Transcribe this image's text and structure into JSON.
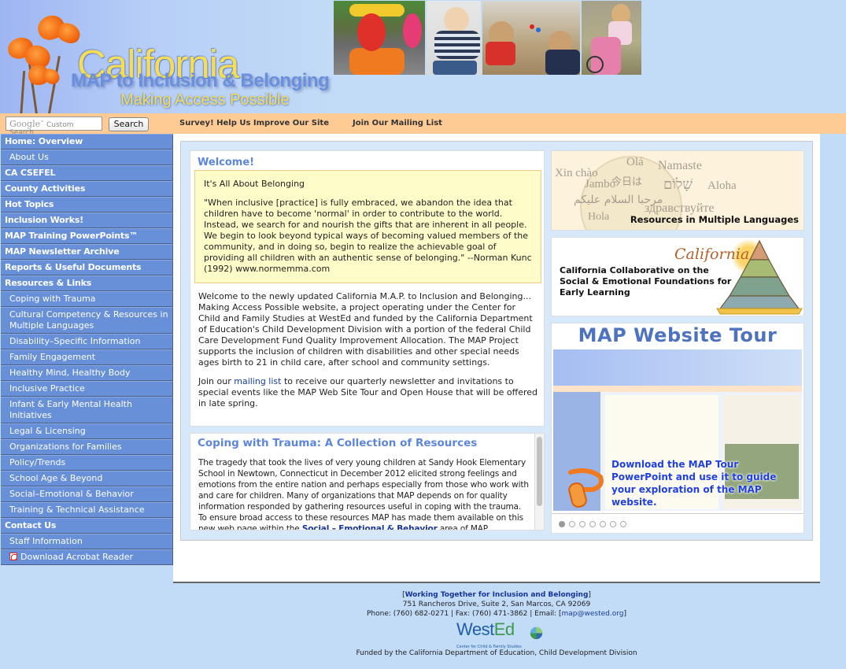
{
  "header": {
    "logo_line1": "California",
    "logo_line2": "MAP to Inclusion & Belonging",
    "logo_line3": "Making Access Possible"
  },
  "topbar": {
    "search_placeholder_brand": "Google",
    "search_placeholder": "Custom Search",
    "search_button": "Search",
    "links": [
      "Survey! Help Us Improve Our Site",
      "Join Our Mailing List"
    ]
  },
  "sidebar": {
    "items": [
      {
        "label": "Home: Overview",
        "level": "top"
      },
      {
        "label": "About Us",
        "level": "sub"
      },
      {
        "label": "CA CSEFEL",
        "level": "top"
      },
      {
        "label": "County Activities",
        "level": "top"
      },
      {
        "label": "Hot Topics",
        "level": "top"
      },
      {
        "label": "Inclusion Works!",
        "level": "top"
      },
      {
        "label": "MAP Training PowerPoints™",
        "level": "top"
      },
      {
        "label": "MAP Newsletter Archive",
        "level": "top"
      },
      {
        "label": "Reports & Useful Documents",
        "level": "top"
      },
      {
        "label": "Resources & Links",
        "level": "top"
      },
      {
        "label": "Coping with Trauma",
        "level": "sub"
      },
      {
        "label": "Cultural Competency & Resources in Multiple Languages",
        "level": "sub"
      },
      {
        "label": "Disability–Specific Information",
        "level": "sub"
      },
      {
        "label": "Family Engagement",
        "level": "sub"
      },
      {
        "label": "Healthy Mind, Healthy Body",
        "level": "sub"
      },
      {
        "label": "Inclusive Practice",
        "level": "sub"
      },
      {
        "label": "Infant & Early Mental Health Initiatives",
        "level": "sub"
      },
      {
        "label": "Legal & Licensing",
        "level": "sub"
      },
      {
        "label": "Organizations for Families",
        "level": "sub"
      },
      {
        "label": "Policy/Trends",
        "level": "sub"
      },
      {
        "label": "School Age & Beyond",
        "level": "sub"
      },
      {
        "label": "Social–Emotional & Behavior",
        "level": "sub"
      },
      {
        "label": "Training & Technical Assistance",
        "level": "sub"
      },
      {
        "label": "Contact Us",
        "level": "top"
      },
      {
        "label": "Staff Information",
        "level": "sub"
      },
      {
        "label": "Download Acrobat Reader",
        "level": "sub",
        "icon": "pdf-icon"
      }
    ]
  },
  "welcome": {
    "title": "Welcome!",
    "quote_heading": "It's All About Belonging",
    "quote": "\"When inclusive [practice] is fully embraced, we abandon the idea that children have to become 'normal' in order to contribute to the world. Instead, we search for and nourish the gifts that are inherent in all people. We begin to look beyond typical ways of becoming valued members of the community, and in doing so, begin to realize the achievable goal of providing all children with an authentic sense of belonging.\" --Norman Kunc (1992) www.normemma.com",
    "intro": "Welcome to the newly updated California M.A.P. to Inclusion and Belonging... Making Access Possible website, a project operating under the Center for Child and Family Studies at WestEd and funded by the California Department of Education's Child Development Division with a portion of the federal Child Care Development Fund Quality Improvement Allocation. The MAP Project supports the inclusion of children with disabilities and other special needs ages birth to 21 in child care, after school and community settings.",
    "join_prefix": "Join our ",
    "join_link": "mailing list",
    "join_suffix": " to receive our quarterly newsletter and invitations to special events like the MAP Web Site Tour and Open House that will be offered in late spring."
  },
  "coping": {
    "title": "Coping with Trauma: A Collection of Resources",
    "body": "The tragedy that took the lives of very young children at Sandy Hook Elementary School in Newtown, Connecticut in December 2012 elicited strong feelings and emotions from the entire nation and perhaps especially from those who work with and care for children. Many of organizations that MAP depends on for quality information responded by gathering resources useful in coping with the trauma. To ensure broad access to these resources MAP has made them available on this new web page within the ",
    "link": "Social – Emotional & Behavior",
    "suffix": " area of MAP."
  },
  "languages_banner": {
    "words": [
      "Xin chào",
      "Olá",
      "Namaste",
      "Jambo",
      "今日は",
      "שָׁלוֹם",
      "Aloha",
      "مرحبا السلام عليكم",
      "здравствуйте",
      "Hola"
    ],
    "caption": "Resources in Multiple Languages"
  },
  "csefel_banner": {
    "script_title": "California",
    "text": "California Collaborative on the Social & Emotional Foundations for Early Learning"
  },
  "tour": {
    "title": "MAP Website Tour",
    "cta": "Download the MAP Tour PowerPoint and use it to guide your exploration of the MAP website.",
    "slides_total": 7,
    "active_slide": 1
  },
  "footer": {
    "tagline": "Working Together for Inclusion and Belonging",
    "address": "751 Rancheros Drive, Suite 2, San Marcos, CA 92069",
    "phone_label": "Phone: (760) 682-0271 | Fax: (760) 471-3862 | Email: [",
    "email": "map@wested.org",
    "logo_word_a": "West",
    "logo_word_b": "Ed",
    "logo_sub": "Center for Child & Family Studies",
    "funded": "Funded by the California Department of Education, Child Development Division"
  },
  "colors": {
    "nav_bg": "#6790d9",
    "topbar_bg": "#fecb95",
    "page_bg": "#c2dbf6",
    "title_blue": "#5c86dc",
    "quote_bg": "#fefcc8"
  }
}
